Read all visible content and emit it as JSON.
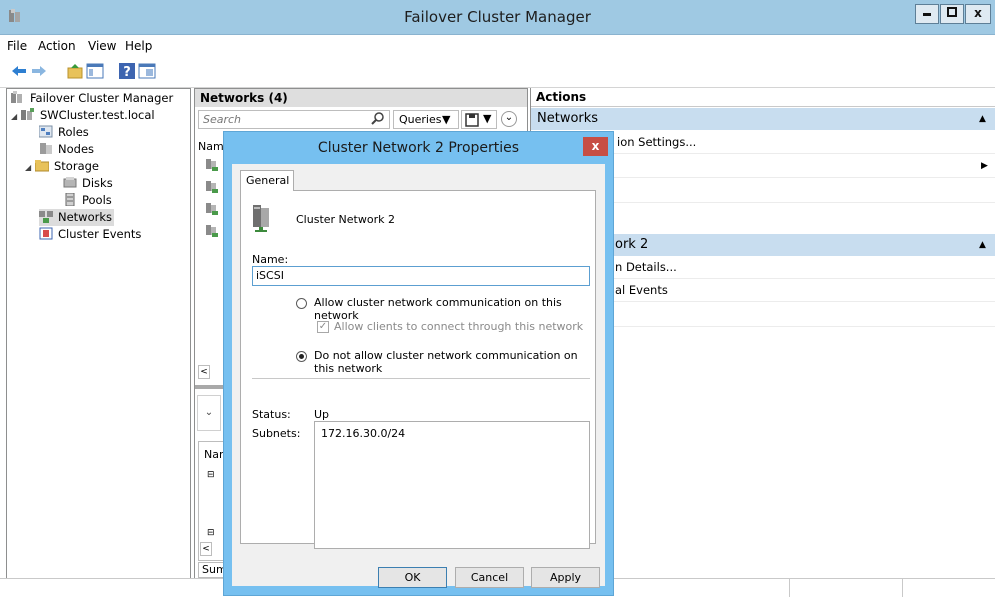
{
  "window": {
    "title": "Failover Cluster Manager",
    "minimize": "‒",
    "maximize": "□",
    "close": "x"
  },
  "menu": [
    "File",
    "Action",
    "View",
    "Help"
  ],
  "toolbar": {
    "icons": [
      "back-icon",
      "forward-icon",
      "up-folder-icon",
      "show-hide-tree-icon",
      "help-icon",
      "properties-icon"
    ]
  },
  "tree": {
    "items": [
      {
        "label": "Failover Cluster Manager",
        "icon": "cluster-manager-icon"
      },
      {
        "label": "SWCluster.test.local",
        "icon": "cluster-icon"
      },
      {
        "label": "Roles",
        "icon": "roles-icon"
      },
      {
        "label": "Nodes",
        "icon": "nodes-icon"
      },
      {
        "label": "Storage",
        "icon": "storage-icon"
      },
      {
        "label": "Disks",
        "icon": "disks-icon"
      },
      {
        "label": "Pools",
        "icon": "pools-icon"
      },
      {
        "label": "Networks",
        "icon": "networks-icon"
      },
      {
        "label": "Cluster Events",
        "icon": "cluster-events-icon"
      }
    ]
  },
  "center": {
    "header": "Networks (4)",
    "search_placeholder": "Search",
    "queries_label": "Queries",
    "column_name": "Nam",
    "lower_column_name": "Nar",
    "summary_tab": "Sum"
  },
  "actions": {
    "header": "Actions",
    "section1": "Networks",
    "section1_items": [
      "ion Settings...",
      "",
      "",
      ""
    ],
    "section2": "ork 2",
    "section2_items": [
      "n Details...",
      "al Events",
      ""
    ]
  },
  "dialog": {
    "title": "Cluster Network 2 Properties",
    "close": "x",
    "tab": "General",
    "network_name": "Cluster Network 2",
    "name_label": "Name:",
    "name_value": "iSCSI",
    "radio_allow": "Allow cluster network communication on this network",
    "check_clients": "Allow clients to connect through this network",
    "radio_deny": "Do not allow cluster network communication on this network",
    "status_label": "Status:",
    "status_value": "Up",
    "subnets_label": "Subnets:",
    "subnets_value": "172.16.30.0/24",
    "ok": "OK",
    "cancel": "Cancel",
    "apply": "Apply",
    "selected_option": "deny",
    "check_clients_checked": true
  }
}
